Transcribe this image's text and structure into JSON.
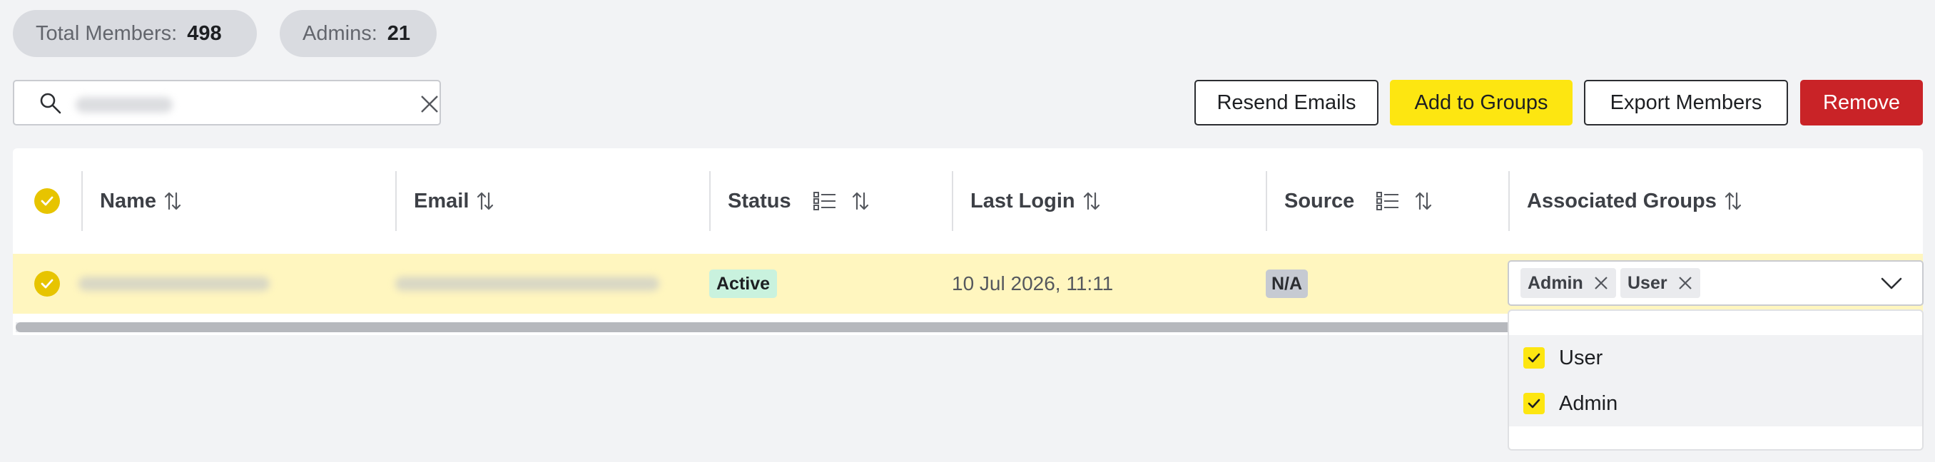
{
  "stats": {
    "total_members_label": "Total Members:",
    "total_members_value": "498",
    "admins_label": "Admins:",
    "admins_value": "21"
  },
  "search": {
    "value": "",
    "placeholder": ""
  },
  "toolbar": {
    "resend_label": "Resend Emails",
    "add_groups_label": "Add to Groups",
    "export_label": "Export Members",
    "remove_label": "Remove"
  },
  "table": {
    "columns": [
      "Name",
      "Email",
      "Status",
      "Last Login",
      "Source",
      "Associated Groups"
    ],
    "rows": [
      {
        "status": "Active",
        "last_login": "10 Jul 2026, 11:11",
        "source": "N/A",
        "groups": [
          "Admin",
          "User"
        ]
      }
    ]
  },
  "group_dropdown": {
    "options": [
      {
        "label": "User",
        "checked": true
      },
      {
        "label": "Admin",
        "checked": true
      }
    ]
  },
  "colors": {
    "accent_yellow": "#fde611",
    "danger_red": "#c92327",
    "row_highlight": "#fff6bf",
    "active_badge": "#c9f2de"
  },
  "icons": [
    "search-icon",
    "clear-icon",
    "sort-icon",
    "filter-list-icon",
    "check-icon",
    "close-icon",
    "chevron-down-icon"
  ]
}
